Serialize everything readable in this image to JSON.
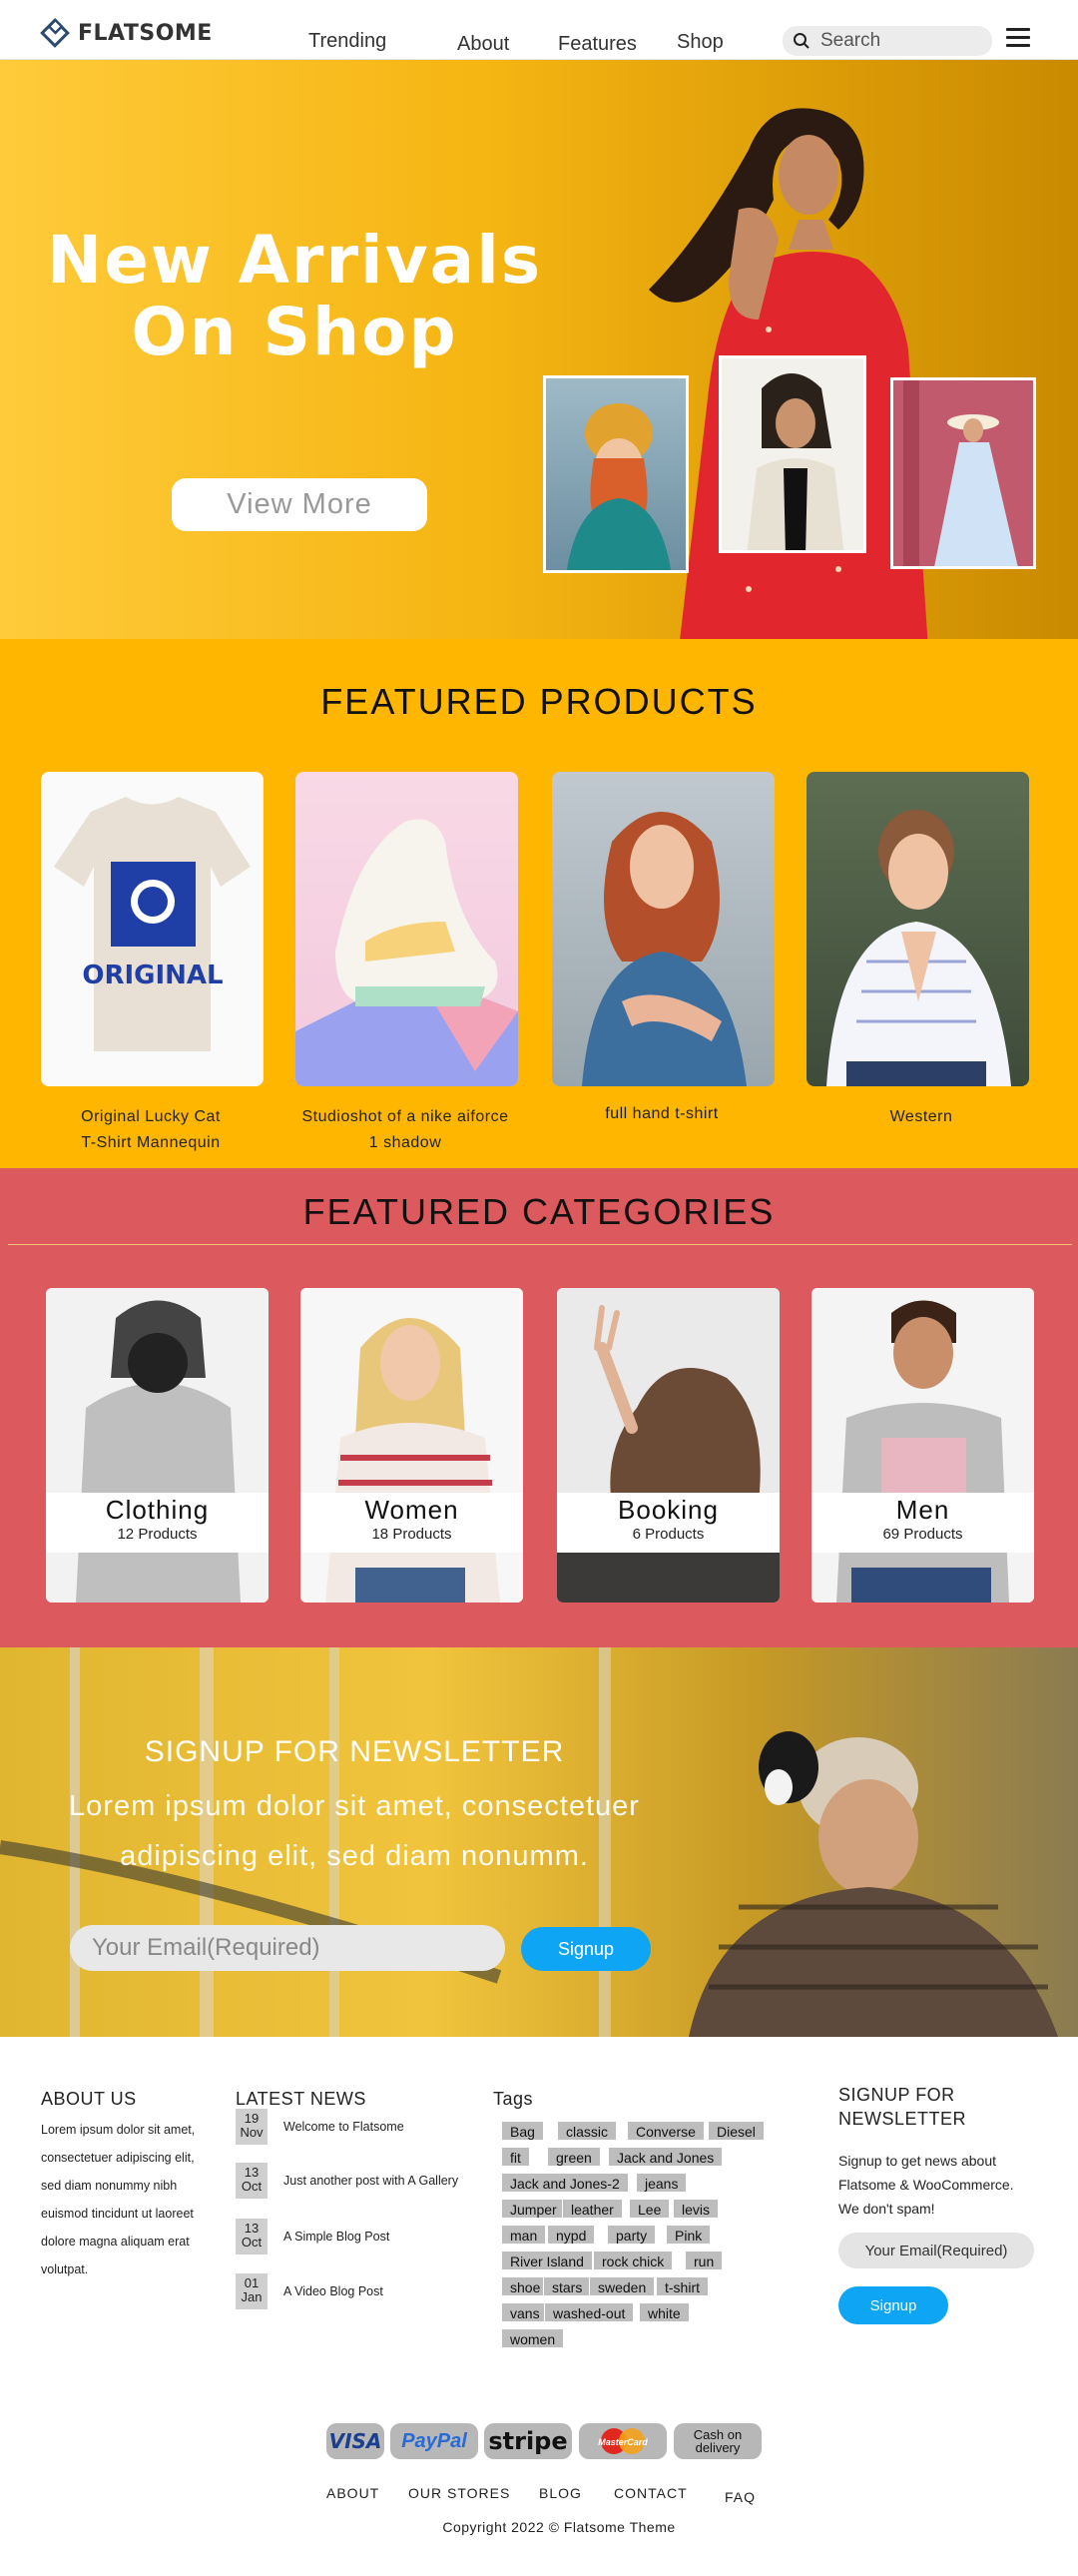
{
  "header": {
    "brand": "FLATSOME",
    "nav": [
      "Trending",
      "About",
      "Features",
      "Shop"
    ],
    "search_placeholder": "Search"
  },
  "hero": {
    "title_line1": "New Arrivals",
    "title_line2": "On Shop",
    "button": "View More"
  },
  "featured_products": {
    "title": "FEATURED PRODUCTS",
    "items": [
      {
        "name_line1": "Original Lucky Cat",
        "name_line2": "T-Shirt Mannequin",
        "print": "ORIGINAL"
      },
      {
        "name_line1": "Studioshot of a nike aiforce",
        "name_line2": "1 shadow"
      },
      {
        "name_line1": "full hand t-shirt",
        "name_line2": ""
      },
      {
        "name_line1": "Western",
        "name_line2": ""
      }
    ]
  },
  "featured_categories": {
    "title": "FEATURED CATEGORIES",
    "items": [
      {
        "name": "Clothing",
        "count": "12 Products"
      },
      {
        "name": "Women",
        "count": "18 Products"
      },
      {
        "name": "Booking",
        "count": "6 Products"
      },
      {
        "name": "Men",
        "count": "69 Products"
      }
    ]
  },
  "newsletter": {
    "title": "SIGNUP FOR NEWSLETTER",
    "text_line1": "Lorem ipsum dolor sit amet, consectetuer",
    "text_line2": "adipiscing elit, sed diam nonumm.",
    "email_placeholder": "Your Email(Required)",
    "button": "Signup"
  },
  "footer": {
    "about_title": "ABOUT US",
    "about_lines": [
      "Lorem ipsum dolor sit amet,",
      "consectetuer adipiscing elit,",
      "sed diam nonummy nibh",
      "euismod tincidunt ut laoreet",
      "dolore magna aliquam erat",
      "volutpat."
    ],
    "news_title": "LATEST NEWS",
    "news": [
      {
        "day": "19",
        "month": "Nov",
        "title": "Welcome to Flatsome"
      },
      {
        "day": "13",
        "month": "Oct",
        "title": "Just another post with A Gallery"
      },
      {
        "day": "13",
        "month": "Oct",
        "title": "A Simple Blog Post"
      },
      {
        "day": "01",
        "month": "Jan",
        "title": "A Video Blog Post"
      }
    ],
    "tags_title": "Tags",
    "tags": [
      "Bag",
      "classic",
      "Converse",
      "Diesel",
      "fit",
      "green",
      "Jack and Jones",
      "Jack and Jones-2",
      "jeans",
      "Jumper",
      "leather",
      "Lee",
      "levis",
      "man",
      "nypd",
      "party",
      "Pink",
      "River Island",
      "rock chick",
      "run",
      "shoe",
      "stars",
      "sweden",
      "t-shirt",
      "vans",
      "washed-out",
      "white",
      "women"
    ],
    "signup_title_line1": "SIGNUP FOR",
    "signup_title_line2": "NEWSLETTER",
    "signup_text_lines": [
      "Signup to get news about",
      "Flatsome & WooCommerce.",
      "We don't spam!"
    ],
    "signup_placeholder": "Your Email(Required)",
    "signup_button": "Signup",
    "payments": [
      "VISA",
      "PayPal",
      "stripe",
      "MasterCard",
      "Cash on",
      "delivery"
    ],
    "links": [
      "ABOUT",
      "OUR STORES",
      "BLOG",
      "CONTACT",
      "FAQ"
    ],
    "copyright": "Copyright 2022 © Flatsome Theme"
  },
  "colors": {
    "hero": "#ffb600",
    "products_bg": "#ffb600",
    "categories_bg": "#dc5a5d",
    "button_blue": "#0ea5f5"
  }
}
